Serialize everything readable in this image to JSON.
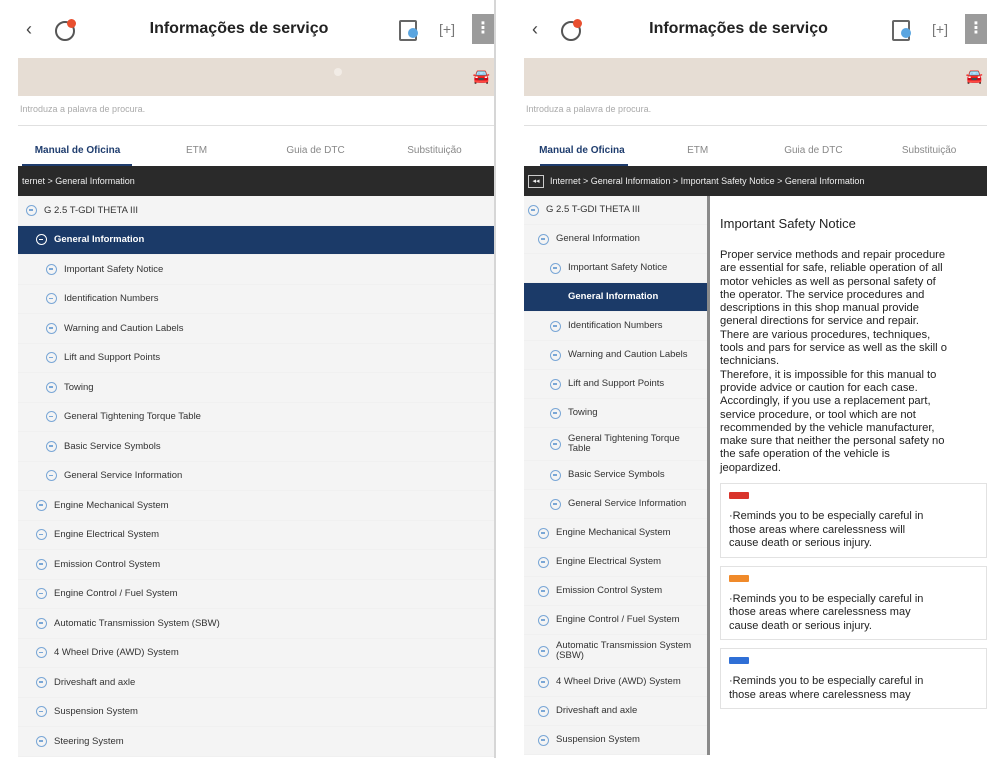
{
  "header": {
    "title": "Informações de serviço",
    "back_glyph": "‹",
    "menu_glyph": "⋮",
    "expand_glyph": "[+]"
  },
  "search": {
    "placeholder": "Introduza a palavra de procura."
  },
  "tabs": [
    {
      "label": "Manual de Oficina",
      "active": true
    },
    {
      "label": "ETM",
      "active": false
    },
    {
      "label": "Guia de DTC",
      "active": false
    },
    {
      "label": "Substituição",
      "active": false
    }
  ],
  "left": {
    "breadcrumb": "ternet > General Information",
    "tree": [
      {
        "label": "G 2.5 T-GDI THETA III",
        "level": 0,
        "active": false
      },
      {
        "label": "General Information",
        "level": 1,
        "active": true
      },
      {
        "label": "Important Safety Notice",
        "level": 2,
        "active": false
      },
      {
        "label": "Identification Numbers",
        "level": 2,
        "active": false
      },
      {
        "label": "Warning and Caution Labels",
        "level": 2,
        "active": false
      },
      {
        "label": "Lift and Support Points",
        "level": 2,
        "active": false
      },
      {
        "label": "Towing",
        "level": 2,
        "active": false
      },
      {
        "label": "General Tightening Torque Table",
        "level": 2,
        "active": false
      },
      {
        "label": "Basic Service Symbols",
        "level": 2,
        "active": false
      },
      {
        "label": "General Service Information",
        "level": 2,
        "active": false
      },
      {
        "label": "Engine Mechanical System",
        "level": 1,
        "active": false
      },
      {
        "label": "Engine Electrical System",
        "level": 1,
        "active": false
      },
      {
        "label": "Emission Control System",
        "level": 1,
        "active": false
      },
      {
        "label": "Engine Control / Fuel System",
        "level": 1,
        "active": false
      },
      {
        "label": "Automatic Transmission System (SBW)",
        "level": 1,
        "active": false
      },
      {
        "label": "4 Wheel Drive (AWD) System",
        "level": 1,
        "active": false
      },
      {
        "label": "Driveshaft and axle",
        "level": 1,
        "active": false
      },
      {
        "label": "Suspension System",
        "level": 1,
        "active": false
      },
      {
        "label": "Steering System",
        "level": 1,
        "active": false
      }
    ]
  },
  "right": {
    "breadcrumb": "Internet > General Information > Important Safety Notice > General Information",
    "breadcrumb_icon": "◂◂",
    "tree": [
      {
        "label": "G 2.5 T-GDI THETA III",
        "level": 0,
        "active": false,
        "tall": false
      },
      {
        "label": "General Information",
        "level": 1,
        "active": false,
        "tall": false
      },
      {
        "label": "Important Safety Notice",
        "level": 2,
        "active": false,
        "tall": false
      },
      {
        "label": "General Information",
        "level": 3,
        "active": true,
        "tall": false
      },
      {
        "label": "Identification Numbers",
        "level": 2,
        "active": false,
        "tall": false
      },
      {
        "label": "Warning and Caution Labels",
        "level": 2,
        "active": false,
        "tall": false
      },
      {
        "label": "Lift and Support Points",
        "level": 2,
        "active": false,
        "tall": false
      },
      {
        "label": "Towing",
        "level": 2,
        "active": false,
        "tall": false
      },
      {
        "label": "General Tightening Torque Table",
        "level": 2,
        "active": false,
        "tall": true
      },
      {
        "label": "Basic Service Symbols",
        "level": 2,
        "active": false,
        "tall": false
      },
      {
        "label": "General Service Information",
        "level": 2,
        "active": false,
        "tall": false
      },
      {
        "label": "Engine Mechanical System",
        "level": 1,
        "active": false,
        "tall": false
      },
      {
        "label": "Engine Electrical System",
        "level": 1,
        "active": false,
        "tall": false
      },
      {
        "label": "Emission Control System",
        "level": 1,
        "active": false,
        "tall": false
      },
      {
        "label": "Engine Control / Fuel System",
        "level": 1,
        "active": false,
        "tall": false
      },
      {
        "label": "Automatic Transmission System (SBW)",
        "level": 1,
        "active": false,
        "tall": true
      },
      {
        "label": "4 Wheel Drive (AWD) System",
        "level": 1,
        "active": false,
        "tall": false
      },
      {
        "label": "Driveshaft and axle",
        "level": 1,
        "active": false,
        "tall": false
      },
      {
        "label": "Suspension System",
        "level": 1,
        "active": false,
        "tall": false
      }
    ],
    "content": {
      "title": "Important Safety Notice",
      "paragraph_lines": [
        "Proper service methods and repair procedure",
        "are essential for safe, reliable operation of all",
        "motor vehicles as well as personal safety of",
        "the operator. The service procedures and",
        "descriptions in this shop manual provide",
        "general directions for service and repair.",
        "There are various procedures, techniques,",
        "tools and pars for service as well as the skill o",
        "technicians.",
        "Therefore, it is impossible for this manual to",
        "provide advice or caution for each case.",
        "Accordingly, if you use a replacement part,",
        "service procedure, or tool which are not",
        "recommended by the vehicle manufacturer,",
        "make sure that neither the personal safety no",
        "the safe operation of the vehicle is",
        "jeopardized."
      ],
      "notices": [
        {
          "color": "#d9342b",
          "lines": [
            "·Reminds you to be especially careful in",
            "  those areas where carelessness will",
            "  cause death or serious injury."
          ]
        },
        {
          "color": "#f08a2a",
          "lines": [
            "·Reminds you to be especially careful in",
            "  those areas where carelessness may",
            "  cause death or serious injury."
          ]
        },
        {
          "color": "#2f6fd6",
          "lines": [
            "·Reminds you to be especially careful in",
            "  those areas where carelessness may"
          ]
        }
      ]
    }
  }
}
